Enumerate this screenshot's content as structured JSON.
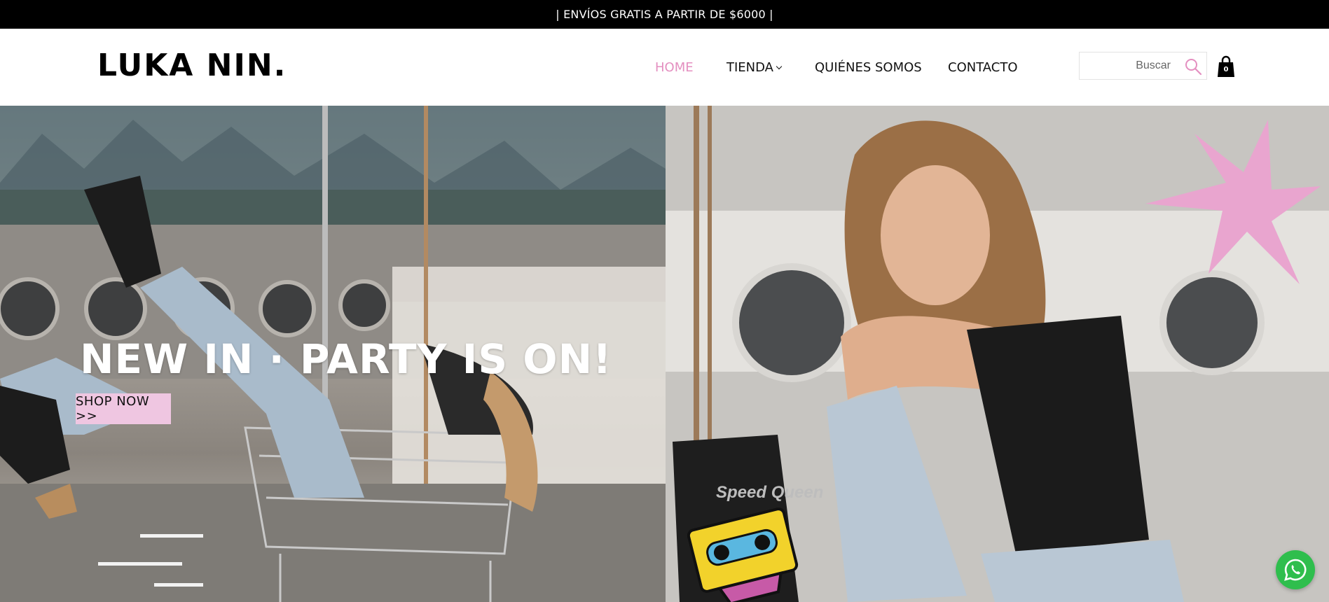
{
  "announcement": {
    "text": "| ENVÍOS GRATIS A PARTIR DE $6000 |"
  },
  "header": {
    "logo": "LUKA NIN.",
    "nav": [
      {
        "label": "HOME",
        "active": true
      },
      {
        "label": "TIENDA",
        "has_dropdown": true
      },
      {
        "label": "QUIÉNES SOMOS"
      },
      {
        "label": "CONTACTO"
      }
    ],
    "search": {
      "placeholder": "Buscar",
      "value": ""
    },
    "cart": {
      "count": "0"
    }
  },
  "hero": {
    "title": "NEW IN · PARTY IS ON!",
    "cta_label": "SHOP NOW >>",
    "cassette_label": "Speed Queen"
  },
  "colors": {
    "accent_pink": "#e48fc0",
    "button_pink": "#efc6e1",
    "whatsapp_green": "#2fbe4d"
  },
  "icons": [
    "search-icon",
    "shopping-bag-icon",
    "chevron-down-icon",
    "whatsapp-icon"
  ]
}
